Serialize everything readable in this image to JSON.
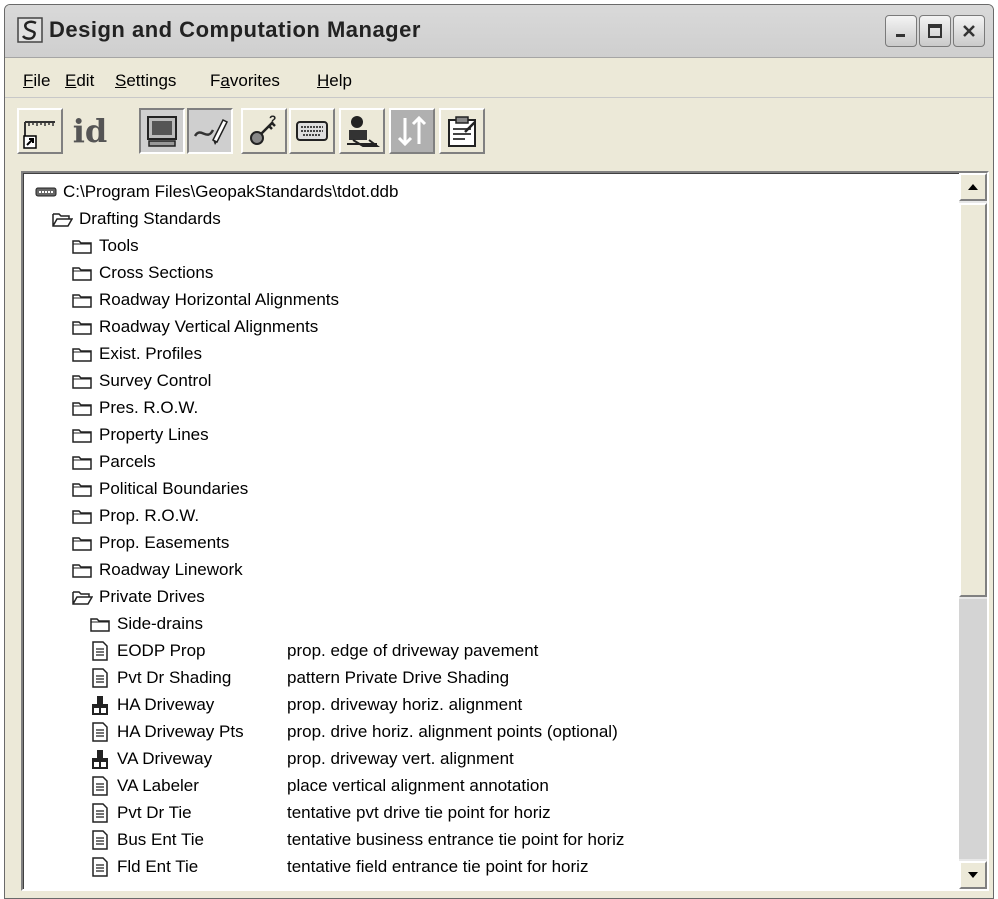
{
  "window": {
    "title": "Design and Computation Manager"
  },
  "menubar": {
    "items": [
      {
        "underline": "F",
        "rest": "ile"
      },
      {
        "underline": "E",
        "rest": "dit"
      },
      {
        "underline": "S",
        "rest": "ettings"
      },
      {
        "prefix": "F",
        "underline": "a",
        "rest": "vorites"
      },
      {
        "underline": "H",
        "rest": "elp"
      }
    ]
  },
  "toolbar": {
    "buttons": [
      {
        "icon": "shortcut-ruler-icon",
        "pressed": false
      },
      {
        "icon": "id-icon",
        "label": "id",
        "pressed": false
      },
      {
        "icon": "display-monitor-icon",
        "pressed": true
      },
      {
        "icon": "draw-pencil-icon",
        "pressed": true
      },
      {
        "icon": "key-settings-icon",
        "pressed": false
      },
      {
        "icon": "keyboard-icon",
        "pressed": false
      },
      {
        "icon": "seat-person-icon",
        "pressed": false
      },
      {
        "icon": "sort-arrows-icon",
        "pressed": false
      },
      {
        "icon": "properties-clipboard-icon",
        "pressed": false
      }
    ]
  },
  "tree": {
    "root": {
      "icon": "database-icon",
      "label": "C:\\Program Files\\GeopakStandards\\tdot.ddb"
    },
    "drafting": {
      "icon": "folder-open-icon",
      "label": "Drafting Standards"
    },
    "folders": [
      "Tools",
      "Cross Sections",
      "Roadway Horizontal Alignments",
      "Roadway Vertical Alignments",
      "Exist. Profiles",
      "Survey Control",
      "Pres. R.O.W.",
      "Property Lines",
      "Parcels",
      "Political Boundaries",
      "Prop. R.O.W.",
      "Prop. Easements",
      "Roadway Linework"
    ],
    "private_drives": {
      "icon": "folder-open-icon",
      "label": "Private Drives"
    },
    "side_drains": {
      "icon": "folder-icon",
      "label": "Side-drains"
    },
    "items": [
      {
        "icon": "document-icon",
        "name": "EODP Prop",
        "desc": "prop. edge of driveway pavement"
      },
      {
        "icon": "document-icon",
        "name": "Pvt Dr Shading",
        "desc": "pattern Private Drive Shading"
      },
      {
        "icon": "alignment-tool-icon",
        "name": "HA Driveway",
        "desc": "prop. driveway horiz. alignment"
      },
      {
        "icon": "document-icon",
        "name": "HA Driveway Pts",
        "desc": "prop. drive horiz. alignment points (optional)"
      },
      {
        "icon": "alignment-tool-icon",
        "name": "VA Driveway",
        "desc": "prop. driveway vert. alignment"
      },
      {
        "icon": "document-icon",
        "name": "VA Labeler",
        "desc": "place vertical alignment annotation"
      },
      {
        "icon": "document-icon",
        "name": "Pvt Dr Tie",
        "desc": "tentative pvt drive tie point for horiz"
      },
      {
        "icon": "document-icon",
        "name": "Bus Ent Tie",
        "desc": "tentative business entrance tie point for horiz"
      },
      {
        "icon": "document-icon",
        "name": "Fld Ent Tie",
        "desc": "tentative field entrance tie point for horiz"
      }
    ]
  },
  "colors": {
    "window_bg": "#ece9d8",
    "titlebar": "#d3d3d3",
    "tree_bg": "#ffffff"
  }
}
